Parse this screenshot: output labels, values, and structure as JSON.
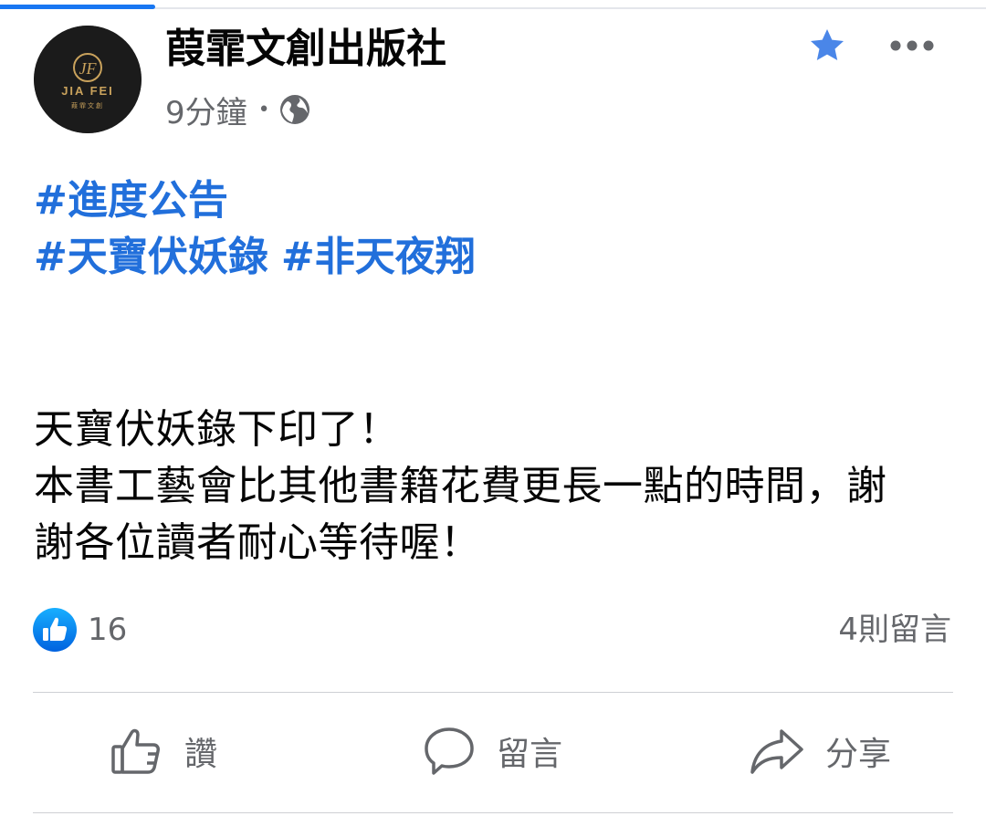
{
  "header": {
    "page_name": "葭霏文創出版社",
    "timestamp": "9分鐘",
    "separator": "•",
    "audience_icon": "globe-icon",
    "avatar": {
      "logo_text": "JIA FEI",
      "logo_subtext": "葭霏文創",
      "logo_letters": "JF"
    },
    "favorite_icon": "star-icon",
    "more_icon": "more-horizontal-icon"
  },
  "post": {
    "hashtag_lines": [
      [
        "#進度公告"
      ],
      [
        "#天寶伏妖錄",
        "#非天夜翔"
      ]
    ],
    "body_lines": [
      "天寶伏妖錄下印了！",
      "本書工藝會比其他書籍花費更長一點的時間，謝",
      "謝各位讀者耐心等待喔！"
    ]
  },
  "reactions": {
    "icon": "like-reaction-icon",
    "count": "16",
    "comments_label": "4則留言"
  },
  "actions": {
    "like_label": "讚",
    "comment_label": "留言",
    "share_label": "分享"
  },
  "colors": {
    "accent": "#1877f2",
    "hashtag": "#216fdb",
    "secondary_text": "#65676b",
    "divider": "#ced0d4",
    "logo_gold": "#c9a25c"
  }
}
